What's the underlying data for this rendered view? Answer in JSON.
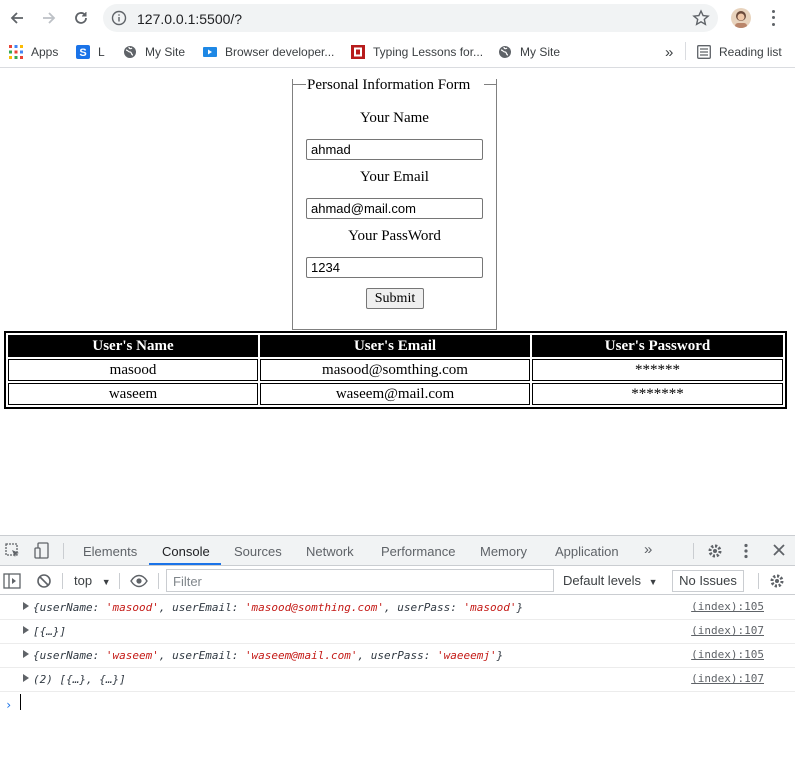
{
  "browser": {
    "url": "127.0.0.1:5500/?",
    "bookmarks": [
      {
        "label": "Apps",
        "icon": "apps-grid-icon"
      },
      {
        "label": "L",
        "icon": "s-logo-icon"
      },
      {
        "label": "My Site",
        "icon": "globe-icon"
      },
      {
        "label": "Browser developer...",
        "icon": "video-icon"
      },
      {
        "label": "Typing Lessons for...",
        "icon": "typing-icon"
      },
      {
        "label": "My Site",
        "icon": "globe-icon"
      }
    ],
    "more_bookmarks": "»",
    "reading_list": "Reading list"
  },
  "form": {
    "legend": "Personal Information Form",
    "name_label": "Your Name",
    "name_value": "ahmad",
    "email_label": "Your Email",
    "email_value": "ahmad@mail.com",
    "password_label": "Your PassWord",
    "password_value": "1234",
    "submit_label": "Submit"
  },
  "table": {
    "headers": [
      "User's Name",
      "User's Email",
      "User's Password"
    ],
    "rows": [
      [
        "masood",
        "masood@somthing.com",
        "******"
      ],
      [
        "waseem",
        "waseem@mail.com",
        "*******"
      ]
    ]
  },
  "devtools": {
    "tabs": [
      "Elements",
      "Console",
      "Sources",
      "Network",
      "Performance",
      "Memory",
      "Application"
    ],
    "active_tab": "Console",
    "more_tabs": "»",
    "context": "top",
    "filter_placeholder": "Filter",
    "levels": "Default levels",
    "issues": "No Issues",
    "logs": [
      {
        "open": "{userName: ",
        "v1": "'masood'",
        "k2": ", userEmail: ",
        "v2": "'masood@somthing.com'",
        "k3": ", userPass: ",
        "v3": "'masood'",
        "close": "}",
        "source": "(index):105"
      },
      {
        "text": "[{…}]",
        "source": "(index):107"
      },
      {
        "open": "{userName: ",
        "v1": "'waseem'",
        "k2": ", userEmail: ",
        "v2": "'waseem@mail.com'",
        "k3": ", userPass: ",
        "v3": "'waeeemj'",
        "close": "}",
        "source": "(index):105"
      },
      {
        "text": "(2) [{…}, {…}]",
        "source": "(index):107"
      }
    ],
    "prompt": "›"
  },
  "colors": {
    "accent": "#1a73e8",
    "string": "#c41a16"
  }
}
